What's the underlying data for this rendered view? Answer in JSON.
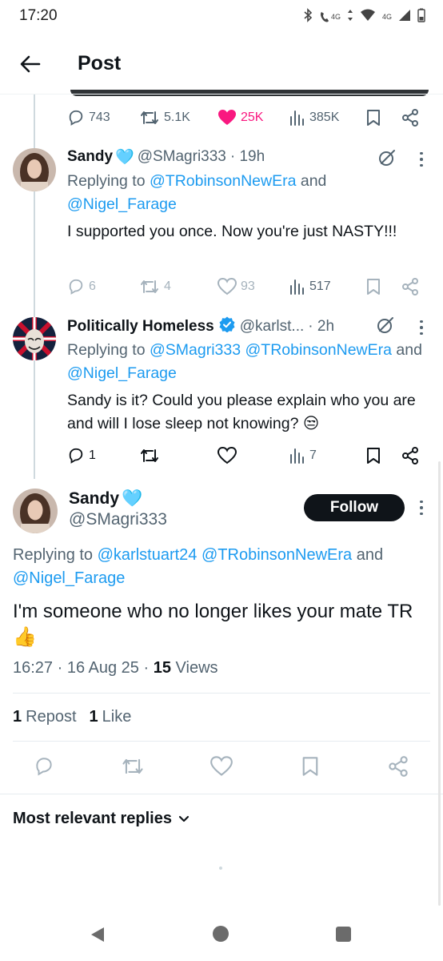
{
  "status_bar": {
    "time": "17:20",
    "network_left": "4G",
    "network_right": "4G"
  },
  "header": {
    "title": "Post"
  },
  "parent_actions": {
    "replies": "743",
    "reposts": "5.1K",
    "likes": "25K",
    "views": "385K"
  },
  "replies": [
    {
      "name": "Sandy",
      "name_emoji": "🩵",
      "handle": "@SMagri333",
      "time": "· 19h",
      "replying_prefix": "Replying to ",
      "replying_to_1": "@TRobinsonNewEra",
      "replying_sep": " and ",
      "replying_to_2": "@Nigel_Farage",
      "text": "I supported you once. Now you're just NASTY!!!",
      "replies": "6",
      "reposts": "4",
      "likes": "93",
      "views": "517"
    },
    {
      "name": "Politically Homeless",
      "handle": "@karlst...",
      "time": "· 2h",
      "replying_prefix": "Replying to ",
      "replying_to_1": "@SMagri333",
      "replying_to_2": "@TRobinsonNewEra",
      "replying_sep": " and ",
      "replying_to_3": "@Nigel_Farage",
      "text": "Sandy is it? Could you please explain who you are and will I lose sleep not knowing?",
      "text_emoji": "😒",
      "replies": "1",
      "views": "7"
    }
  ],
  "main_post": {
    "name": "Sandy",
    "name_emoji": "🩵",
    "handle": "@SMagri333",
    "follow_label": "Follow",
    "replying_prefix": "Replying to ",
    "replying_to_1": "@karlstuart24",
    "replying_to_2": "@TRobinsonNewEra",
    "replying_sep": " and ",
    "replying_to_3": "@Nigel_Farage",
    "text": "I'm someone who no longer likes your mate TR",
    "text_emoji": "👍",
    "time": "16:27",
    "date": "· 16 Aug 25 ·",
    "views_count": "15",
    "views_label": "Views",
    "reposts_count": "1",
    "reposts_label": "Repost",
    "likes_count": "1",
    "likes_label": "Like"
  },
  "sort": {
    "label": "Most relevant replies"
  },
  "colors": {
    "accent": "#1d9bf0",
    "like_active": "#f91880",
    "text": "#0f1419",
    "muted": "#536471"
  },
  "icons": [
    "back-arrow-icon",
    "reply-icon",
    "repost-icon",
    "like-icon",
    "views-icon",
    "bookmark-icon",
    "share-icon",
    "grok-icon",
    "more-icon",
    "verified-icon",
    "chevron-down-icon"
  ]
}
